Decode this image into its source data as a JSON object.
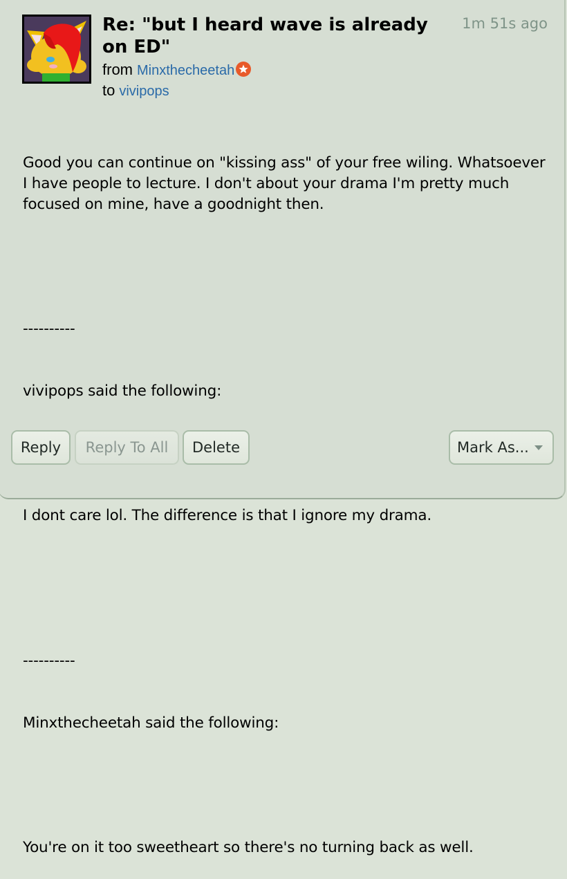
{
  "message": {
    "subject": "Re: \"but I heard wave is already on ED\"",
    "timestamp": "1m 51s ago",
    "from_label": "from",
    "from_user": "Minxthecheetah",
    "from_badge_icon": "star-badge-icon",
    "to_label": "to",
    "to_user": "vivipops",
    "avatar_icon": "user-avatar",
    "body": {
      "paragraph1": "Good you can continue on \"kissing ass\" of your free wiling. Whatsoever I have people to lecture. I don't about your drama I'm pretty much focused on mine, have a goodnight then.",
      "separator1": "----------",
      "quote1_header": "vivipops said the following:",
      "quote1_text": "I dont care lol. The difference is that I ignore my drama.",
      "separator2": "----------",
      "quote2_header": "Minxthecheetah said the following:",
      "quote2_text": "You're on it too sweetheart so there's no turning back as well."
    }
  },
  "actions": {
    "reply": "Reply",
    "reply_all": "Reply To All",
    "delete": "Delete",
    "mark_as": "Mark As..."
  },
  "colors": {
    "background": "#d6ded3",
    "link": "#2a6aa8",
    "badge": "#e85a2a",
    "timestamp": "#7f9488"
  }
}
